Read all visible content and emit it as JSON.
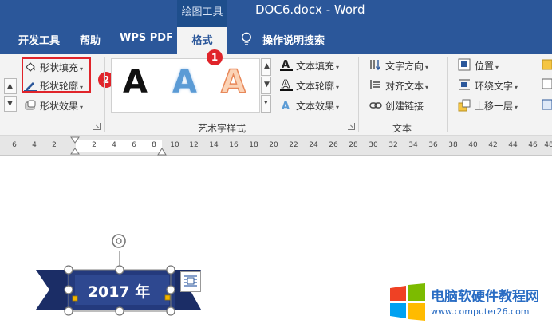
{
  "window": {
    "context_tab_group": "绘图工具",
    "title": "DOC6.docx  -  Word"
  },
  "tabs": [
    {
      "label": "开发工具"
    },
    {
      "label": "帮助"
    },
    {
      "label": "WPS PDF"
    },
    {
      "label": "格式",
      "active": true
    }
  ],
  "tell_me": {
    "label": "操作说明搜索"
  },
  "markers": {
    "one": "1",
    "two": "2"
  },
  "ribbon": {
    "shape_styles": {
      "fill": "形状填充",
      "outline": "形状轮廓",
      "effects": "形状效果"
    },
    "wordart_styles": {
      "label": "艺术字样式",
      "gallery": [
        "A",
        "A",
        "A"
      ],
      "text_fill": "文本填充",
      "text_outline": "文本轮廓",
      "text_effects": "文本效果"
    },
    "text": {
      "label": "文本",
      "direction": "文字方向",
      "align": "对齐文本",
      "link": "创建链接"
    },
    "arrange": {
      "position": "位置",
      "wrap": "环绕文字",
      "forward": "上移一层"
    }
  },
  "ruler": {
    "numbers": [
      "6",
      "4",
      "2",
      "2",
      "4",
      "6",
      "8",
      "10",
      "12",
      "14",
      "16",
      "18",
      "20",
      "22",
      "24",
      "26",
      "28",
      "30",
      "32",
      "34",
      "36",
      "38",
      "40",
      "42",
      "44",
      "46",
      "48"
    ]
  },
  "document": {
    "wordart_text": "2017 年"
  },
  "watermark": {
    "text": "电脑软硬件教程网",
    "url": "www.computer26.com"
  },
  "colors": {
    "titlebar": "#2b579a",
    "ribbon": "#f3f3f3",
    "highlight": "#e0242a",
    "banner_dark": "#1b2d66",
    "banner_light": "#2a4488"
  }
}
